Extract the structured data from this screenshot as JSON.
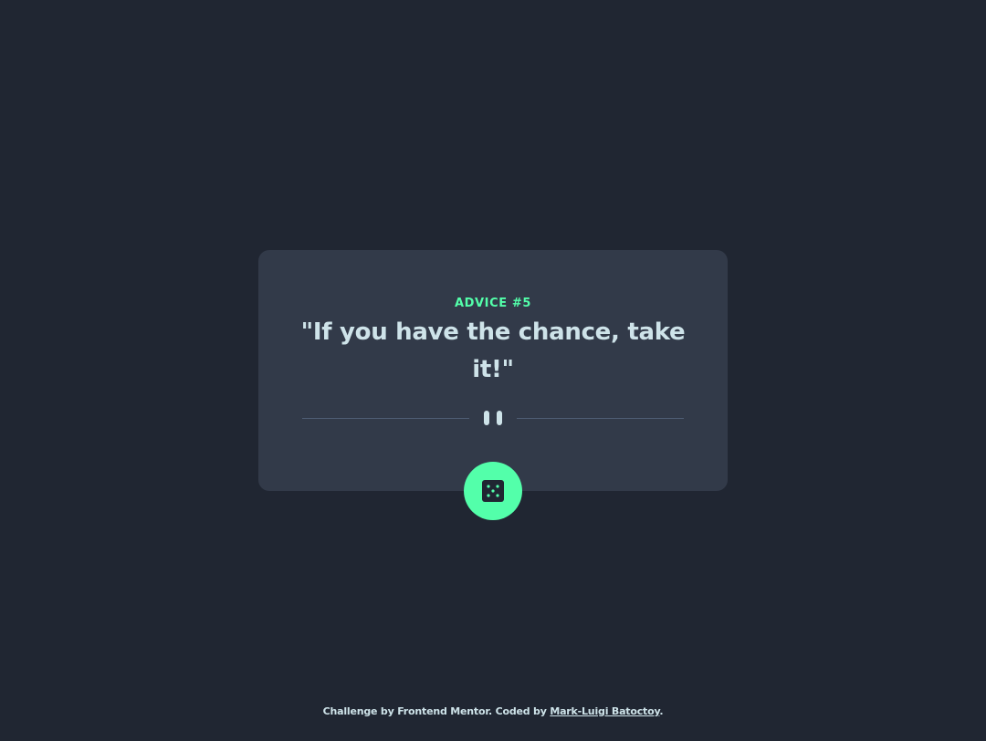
{
  "advice": {
    "label": "ADVICE #5",
    "quote": "\"If you have the chance, take it!\""
  },
  "dice_button": {
    "icon": "dice-icon"
  },
  "footer": {
    "prefix": "Challenge by Frontend Mentor. Coded by ",
    "author_link": "Mark-Luigi Batoctoy",
    "suffix": "."
  },
  "colors": {
    "background": "#202632",
    "card": "#323a49",
    "accent": "#53ffaa",
    "text": "#cee3e9",
    "divider": "#4f5d74"
  }
}
